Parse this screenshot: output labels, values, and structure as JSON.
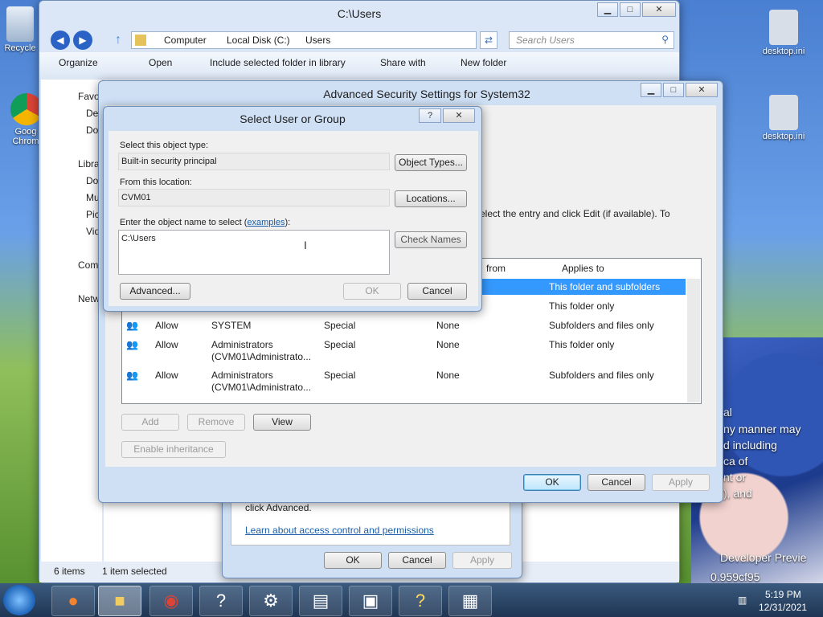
{
  "desktop": {
    "icons": [
      {
        "label": "Recycle",
        "name": "recycle-bin-icon"
      },
      {
        "label": "Goog Chrom",
        "name": "chrome-icon"
      },
      {
        "label": "desktop.ini",
        "name": "desktop-ini-icon"
      },
      {
        "label": "desktop.ini",
        "name": "desktop-ini-icon-2"
      }
    ],
    "bg_lines": [
      "al",
      "ny manner may",
      "d including",
      "ca of",
      "nt or",
      "), and",
      "Developer Previe",
      "0.959cf95"
    ]
  },
  "explorer": {
    "title": "C:\\Users",
    "breadcrumb": [
      "Computer",
      "Local Disk (C:)",
      "Users"
    ],
    "search_placeholder": "Search Users",
    "toolbar": [
      "Organize",
      "Open",
      "Include selected folder in library",
      "Share with",
      "New folder"
    ],
    "nav": {
      "favorites": "Favo",
      "fav_items": [
        "De",
        "Do"
      ],
      "libraries": "Libra",
      "lib_items": [
        "Do",
        "Mu",
        "Pic",
        "Vid"
      ],
      "computer": "Com",
      "network": "Netw"
    },
    "status": {
      "items": "6 items",
      "selected": "1 item selected"
    }
  },
  "properties": {
    "advanced_text": "click Advanced.",
    "link": "Learn about access control and permissions",
    "ok": "OK",
    "cancel": "Cancel",
    "apply": "Apply"
  },
  "advanced_security": {
    "title": "Advanced Security Settings for System32",
    "instruction": "elect the entry and click Edit (if available). To",
    "columns": {
      "inherited": "from",
      "applies": "Applies to"
    },
    "rows": [
      {
        "type": "",
        "principal": "",
        "principal2": "",
        "access": "",
        "inherited": "",
        "applies": "This folder and subfolders",
        "selected": true
      },
      {
        "type": "",
        "principal": "",
        "principal2": "",
        "access": "",
        "inherited": "",
        "applies": "This folder only",
        "selected": false
      },
      {
        "type": "Allow",
        "principal": "SYSTEM",
        "principal2": "",
        "access": "Special",
        "inherited": "None",
        "applies": "Subfolders and files only",
        "selected": false
      },
      {
        "type": "Allow",
        "principal": "Administrators",
        "principal2": "(CVM01\\Administrato...",
        "access": "Special",
        "inherited": "None",
        "applies": "This folder only",
        "selected": false
      },
      {
        "type": "Allow",
        "principal": "Administrators",
        "principal2": "(CVM01\\Administrato...",
        "access": "Special",
        "inherited": "None",
        "applies": "Subfolders and files only",
        "selected": false
      }
    ],
    "buttons": {
      "add": "Add",
      "remove": "Remove",
      "view": "View",
      "inheritance": "Enable inheritance",
      "ok": "OK",
      "cancel": "Cancel",
      "apply": "Apply"
    }
  },
  "select_dialog": {
    "title": "Select User or Group",
    "help": "?",
    "object_type_label": "Select this object type:",
    "object_type_value": "Built-in security principal",
    "object_types_btn": "Object Types...",
    "location_label": "From this location:",
    "location_value": "CVM01",
    "locations_btn": "Locations...",
    "name_label": "Enter the object name to select (",
    "name_link": "examples",
    "name_label_end": "):",
    "name_value": "C:\\Users",
    "check_names_btn": "Check Names",
    "advanced_btn": "Advanced...",
    "ok_btn": "OK",
    "cancel_btn": "Cancel"
  },
  "taskbar": {
    "time": "5:19 PM",
    "date": "12/31/2021"
  }
}
